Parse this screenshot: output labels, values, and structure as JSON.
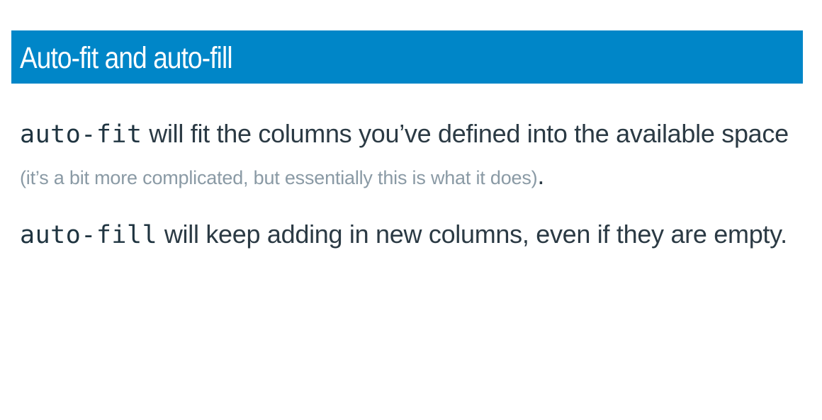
{
  "slide": {
    "title": "Auto-fit and auto-fill",
    "colors": {
      "title_bar_background": "#0086c8",
      "title_text": "#ffffff",
      "body_text": "#2b3a44",
      "aside_text": "#8a9aa5"
    },
    "paragraphs": [
      {
        "code": "auto-fit",
        "text": " will fit the columns you’ve defined into the available space ",
        "aside": "(it’s a bit more complicated, but essentially this is what it does)",
        "end": "."
      },
      {
        "code": "auto-fill",
        "text": " will keep adding in new columns, even if they are empty."
      }
    ]
  }
}
